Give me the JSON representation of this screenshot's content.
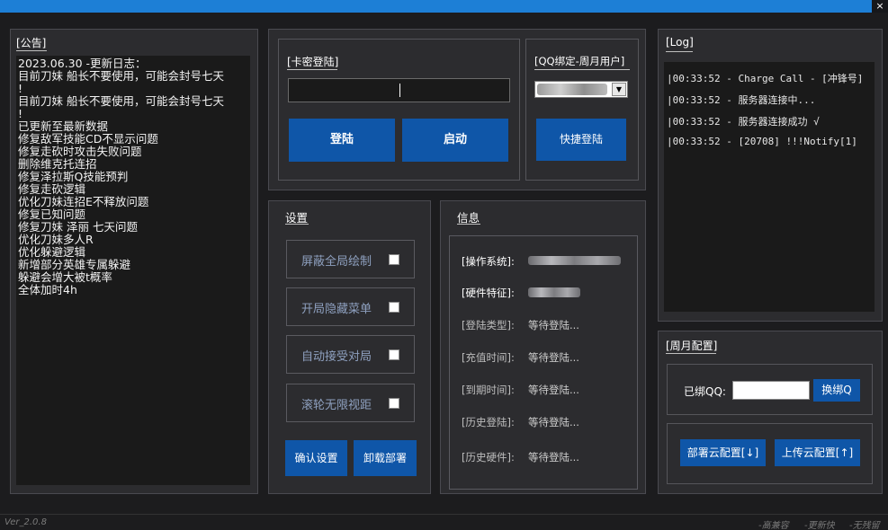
{
  "window": {
    "close_label": "×"
  },
  "announcement": {
    "title": "[公告]",
    "lines": [
      "2023.06.30 -更新日志：",
      "",
      "目前刀妹 船长不要使用，可能会封号七天",
      "!",
      "目前刀妹 船长不要使用，可能会封号七天",
      "!",
      "",
      "已更新至最新数据",
      "修复敌军技能CD不显示问题",
      "修复走砍时攻击失败问题",
      "删除维克托连招",
      "修复泽拉斯Q技能预判",
      "修复走砍逻辑",
      "优化刀妹连招E不释放问题",
      "修复已知问题",
      "修复刀妹 泽丽 七天问题",
      "优化刀妹多人R",
      "优化躲避逻辑",
      "新增部分英雄专属躲避",
      "",
      "躲避会增大被t概率",
      "",
      "全体加时4h"
    ]
  },
  "login": {
    "title": "[卡密登陆]",
    "card_value": "",
    "login_button": "登陆",
    "start_button": "启动"
  },
  "qq_bind": {
    "title": "[QQ绑定-周月用户]",
    "quick_login_button": "快捷登陆"
  },
  "settings": {
    "title": "设置",
    "options": [
      {
        "label": "屏蔽全局绘制",
        "checked": false
      },
      {
        "label": "开局隐藏菜单",
        "checked": false
      },
      {
        "label": "自动接受对局",
        "checked": false
      },
      {
        "label": "滚轮无限视距",
        "checked": false
      }
    ],
    "confirm_button": "确认设置",
    "uninstall_button": "卸载部署"
  },
  "info": {
    "title": "信息",
    "rows": [
      {
        "label": "[操作系统]:",
        "value": ""
      },
      {
        "label": "[硬件特征]:",
        "value": ""
      },
      {
        "label": "[登陆类型]:",
        "value": "等待登陆..."
      },
      {
        "label": "[充值时间]:",
        "value": "等待登陆..."
      },
      {
        "label": "[到期时间]:",
        "value": "等待登陆..."
      },
      {
        "label": "[历史登陆]:",
        "value": "等待登陆..."
      },
      {
        "label": "[历史硬件]:",
        "value": "等待登陆..."
      }
    ]
  },
  "log": {
    "title": "[Log]",
    "lines": [
      "|00:33:52 - Charge Call - [冲锋号]",
      "|00:33:52 - 服务器连接中...",
      "|00:33:52 - 服务器连接成功 √",
      "|00:33:52 - [20708] !!!Notify[1]"
    ]
  },
  "monthly": {
    "title": "[周月配置]",
    "bound_qq_label": "已绑QQ:",
    "bound_qq_value": "",
    "rebind_button": "换绑Q",
    "deploy_button": "部署云配置[↓]",
    "upload_button": "上传云配置[↑]"
  },
  "footer": {
    "version": "Ver_2.0.8",
    "tag1": "-高兼容",
    "tag2": "-更新快",
    "tag3": "-无残留"
  },
  "colors": {
    "accent": "#1d7fd6",
    "button": "#0f56a8",
    "background": "#1c1c1e",
    "panel": "#2c2c2f"
  }
}
